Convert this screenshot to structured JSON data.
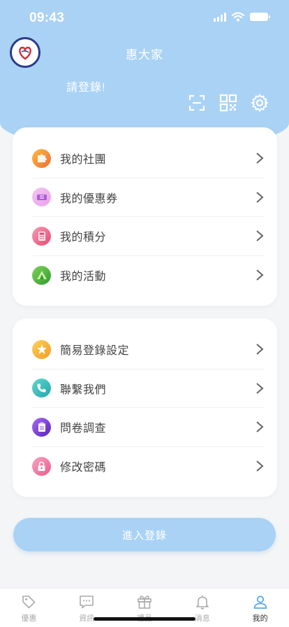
{
  "status_bar": {
    "time": "09:43"
  },
  "header": {
    "title": "惠大家",
    "login_prompt": "請登錄!",
    "actions": [
      "scan-icon",
      "qr-code-icon",
      "gear-icon"
    ]
  },
  "menu_group_1": [
    {
      "label": "我的社團",
      "icon": "puzzle-icon",
      "color": "#f5a623"
    },
    {
      "label": "我的優惠券",
      "icon": "ticket-icon",
      "color": "#d98be0"
    },
    {
      "label": "我的積分",
      "icon": "calculator-icon",
      "color": "#f06a8a"
    },
    {
      "label": "我的活動",
      "icon": "tent-icon",
      "color": "#5cbf47"
    }
  ],
  "menu_group_2": [
    {
      "label": "簡易登錄設定",
      "icon": "star-icon",
      "color": "#f7b733"
    },
    {
      "label": "聯繫我們",
      "icon": "phone-icon",
      "color": "#3cc0b8"
    },
    {
      "label": "問卷調查",
      "icon": "clipboard-icon",
      "color": "#7a3fd6"
    },
    {
      "label": "修改密碼",
      "icon": "lock-icon",
      "color": "#f07aa0"
    }
  ],
  "enter_button": {
    "label": "進入登錄"
  },
  "tabbar": [
    {
      "label": "優惠",
      "icon": "tag-icon"
    },
    {
      "label": "資訊",
      "icon": "chat-icon"
    },
    {
      "label": "禮品",
      "icon": "gift-icon"
    },
    {
      "label": "消息",
      "icon": "bell-icon"
    },
    {
      "label": "我的",
      "icon": "user-icon",
      "active": true
    }
  ]
}
